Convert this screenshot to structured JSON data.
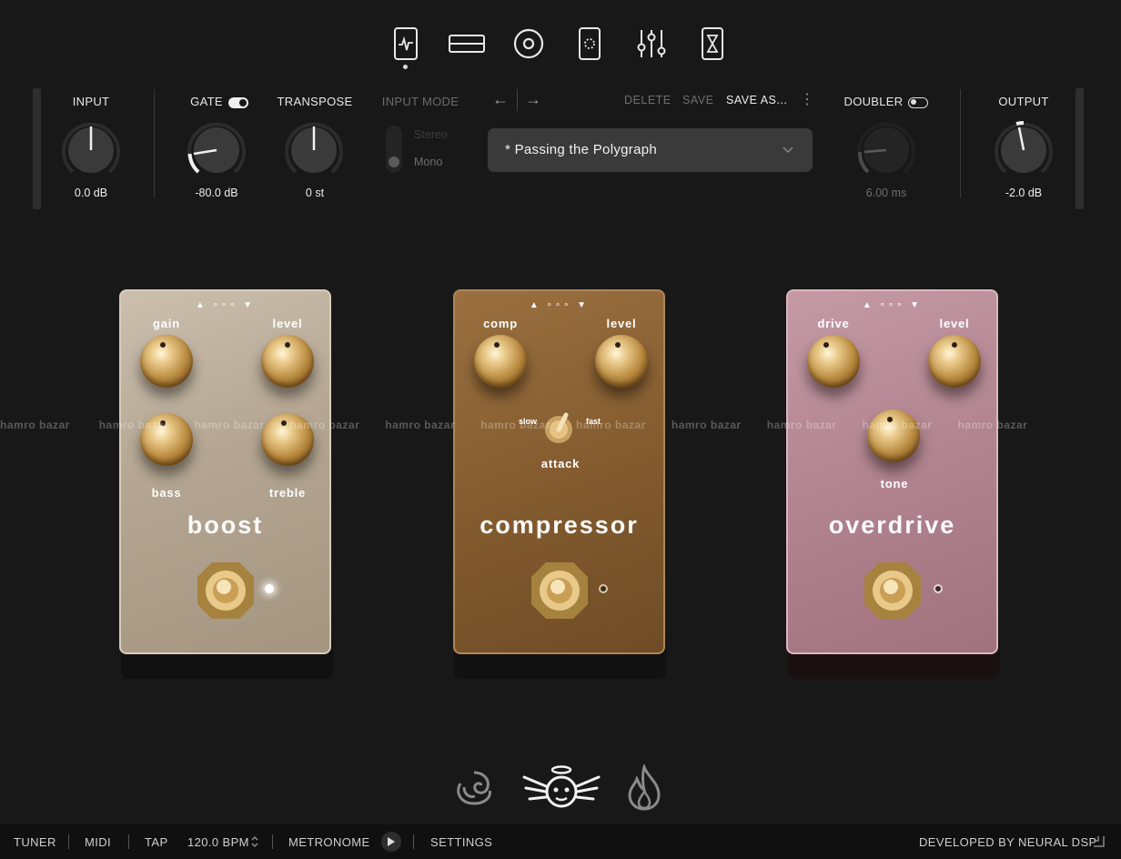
{
  "nav": {
    "icons": [
      "amp-icon",
      "cabinet-icon",
      "speaker-icon",
      "mic-icon",
      "eq-sliders-icon",
      "hourglass-icon"
    ]
  },
  "input": {
    "label": "INPUT",
    "value": "0.0 dB",
    "level": 0.5
  },
  "gate": {
    "label": "GATE",
    "value": "-80.0 dB",
    "enabled": true
  },
  "transpose": {
    "label": "TRANSPOSE",
    "value": "0 st"
  },
  "input_mode": {
    "label": "INPUT MODE",
    "options": [
      "Stereo",
      "Mono"
    ],
    "selected": "Mono"
  },
  "preset": {
    "name": "* Passing the Polygraph",
    "back_arrow": "←",
    "forward_arrow": "→",
    "delete": "DELETE",
    "save": "SAVE",
    "save_as": "SAVE AS...",
    "more": "⋮"
  },
  "doubler": {
    "label": "DOUBLER",
    "value": "6.00 ms",
    "enabled": false
  },
  "output": {
    "label": "OUTPUT",
    "value": "-2.0 dB"
  },
  "pedals": [
    {
      "name": "boost",
      "knobs": [
        "gain",
        "level",
        "bass",
        "treble"
      ],
      "color": "#b8ab98",
      "on": true
    },
    {
      "name": "compressor",
      "knobs": [
        "comp",
        "level"
      ],
      "switch": {
        "label": "attack",
        "left": "slow",
        "right": "fast"
      },
      "color": "#8a6232",
      "on": false
    },
    {
      "name": "overdrive",
      "knobs": [
        "drive",
        "level",
        "tone"
      ],
      "color": "#b48793",
      "on": false
    }
  ],
  "watermark": "hamro bazar",
  "modes": [
    "rose-icon",
    "angel-icon",
    "flame-icon"
  ],
  "bottom": {
    "tuner": "TUNER",
    "midi": "MIDI",
    "tap": "TAP",
    "bpm": "120.0 BPM",
    "metronome": "METRONOME",
    "settings": "SETTINGS",
    "credit": "DEVELOPED BY NEURAL DSP"
  }
}
